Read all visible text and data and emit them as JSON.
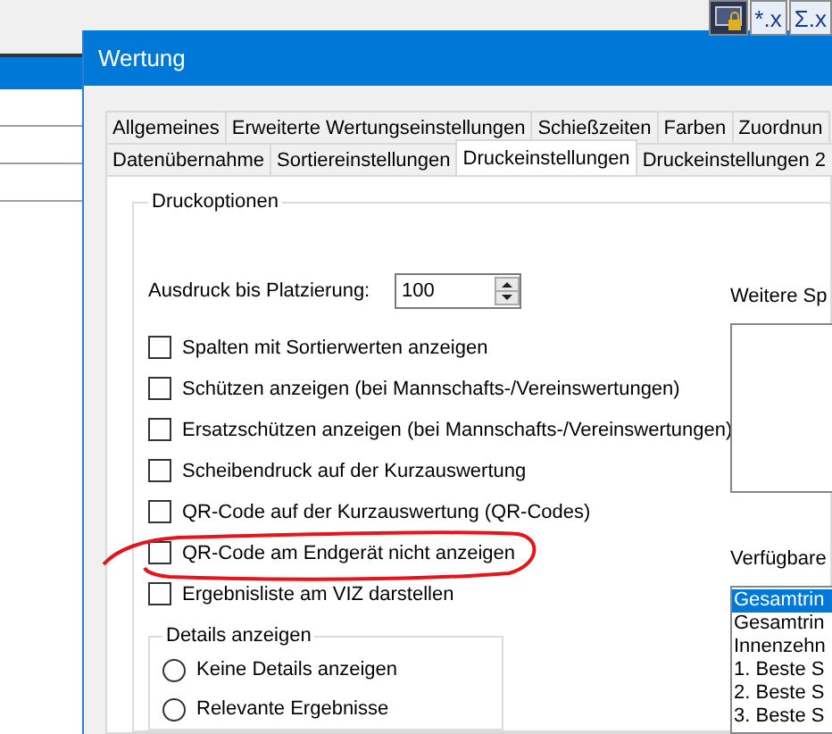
{
  "toolbar_buttons": [
    {
      "kind": "icon"
    },
    {
      "kind": "text",
      "label": "*.x"
    },
    {
      "kind": "text",
      "label": "Σ.x"
    }
  ],
  "dialog": {
    "title": "Wertung",
    "tab_rows": [
      [
        {
          "label": "Allgemeines",
          "selected": false
        },
        {
          "label": "Erweiterte Wertungseinstellungen",
          "selected": false
        },
        {
          "label": "Schießzeiten",
          "selected": false
        },
        {
          "label": "Farben",
          "selected": false
        },
        {
          "label": "Zuordnun",
          "selected": false
        }
      ],
      [
        {
          "label": "Datenübernahme",
          "selected": false
        },
        {
          "label": "Sortiereinstellungen",
          "selected": false
        },
        {
          "label": "Druckeinstellungen",
          "selected": true
        },
        {
          "label": "Druckeinstellungen 2",
          "selected": false
        }
      ]
    ],
    "print_options": {
      "title": "Druckoptionen",
      "placement": {
        "label": "Ausdruck bis Platzierung:",
        "value": "100"
      },
      "checkboxes": [
        {
          "label": "Spalten mit Sortierwerten anzeigen",
          "checked": false
        },
        {
          "label": "Schützen anzeigen (bei Mannschafts-/Vereinswertungen)",
          "checked": false
        },
        {
          "label": "Ersatzschützen anzeigen (bei Mannschafts-/Vereinswertungen)",
          "checked": false
        },
        {
          "label": "Scheibendruck auf der Kurzauswertung",
          "checked": false
        },
        {
          "label": "QR-Code auf der Kurzauswertung (QR-Codes)",
          "checked": false
        },
        {
          "label": "QR-Code am Endgerät nicht anzeigen",
          "checked": false
        },
        {
          "label": "Ergebnisliste am VIZ darstellen",
          "checked": false
        }
      ],
      "details": {
        "title": "Details anzeigen",
        "options": [
          {
            "label": "Keine Details anzeigen",
            "selected": false
          },
          {
            "label": "Relevante Ergebnisse",
            "selected": false
          }
        ]
      },
      "more_columns": {
        "label": "Weitere Sp"
      },
      "available": {
        "label": "Verfügbare",
        "items": [
          {
            "label": "Gesamtrin",
            "selected": true
          },
          {
            "label": "Gesamtrin",
            "selected": false
          },
          {
            "label": "Innenzehn",
            "selected": false
          },
          {
            "label": "1. Beste S",
            "selected": false
          },
          {
            "label": "2. Beste S",
            "selected": false
          },
          {
            "label": "3. Beste S",
            "selected": false
          }
        ]
      }
    }
  },
  "annotation": {
    "kind": "ellipse"
  }
}
